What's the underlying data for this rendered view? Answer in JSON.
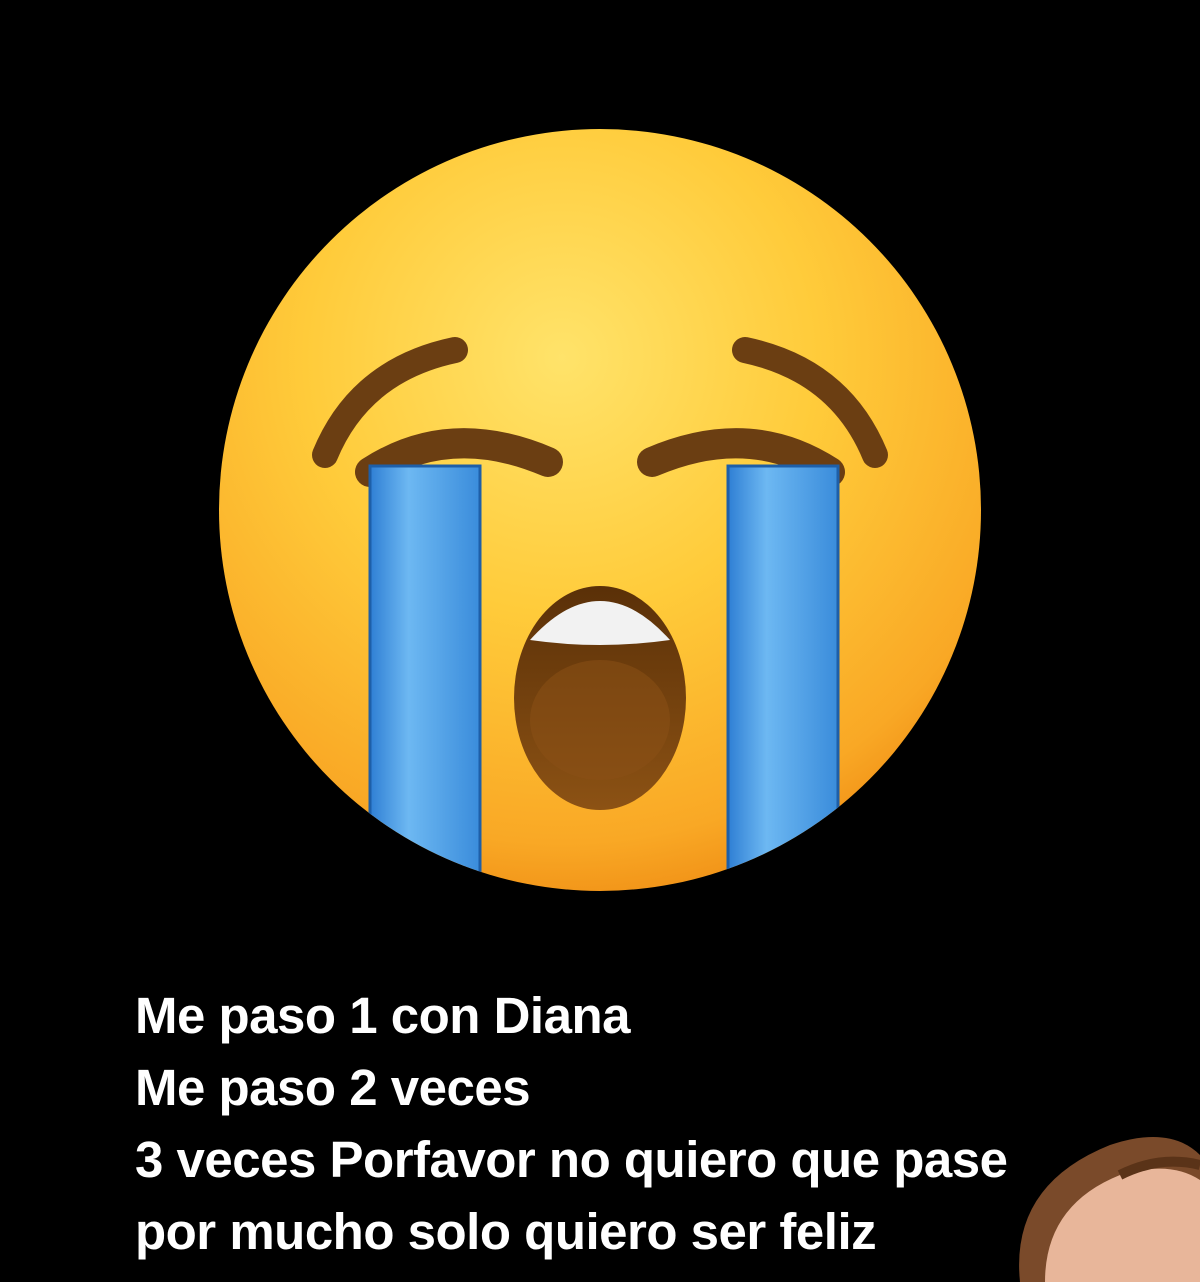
{
  "image": {
    "background_color": "#000000",
    "subject": "loudly-crying-face-emoji-icon",
    "colors": {
      "face_yellow": "#FFCB3A",
      "face_orange": "#F7A21B",
      "tears_blue": "#4EA3E8",
      "brows_brown": "#6B3E12",
      "mouth_brown": "#7A4510",
      "teeth_white": "#F2F2F2",
      "caption_text": "#FFFFFF"
    }
  },
  "caption": {
    "lines": [
      "Me paso 1 con Diana",
      "Me paso 2 veces",
      "3 veces Porfavor no quiero que pase",
      "por mucho solo quiero ser feliz"
    ]
  }
}
